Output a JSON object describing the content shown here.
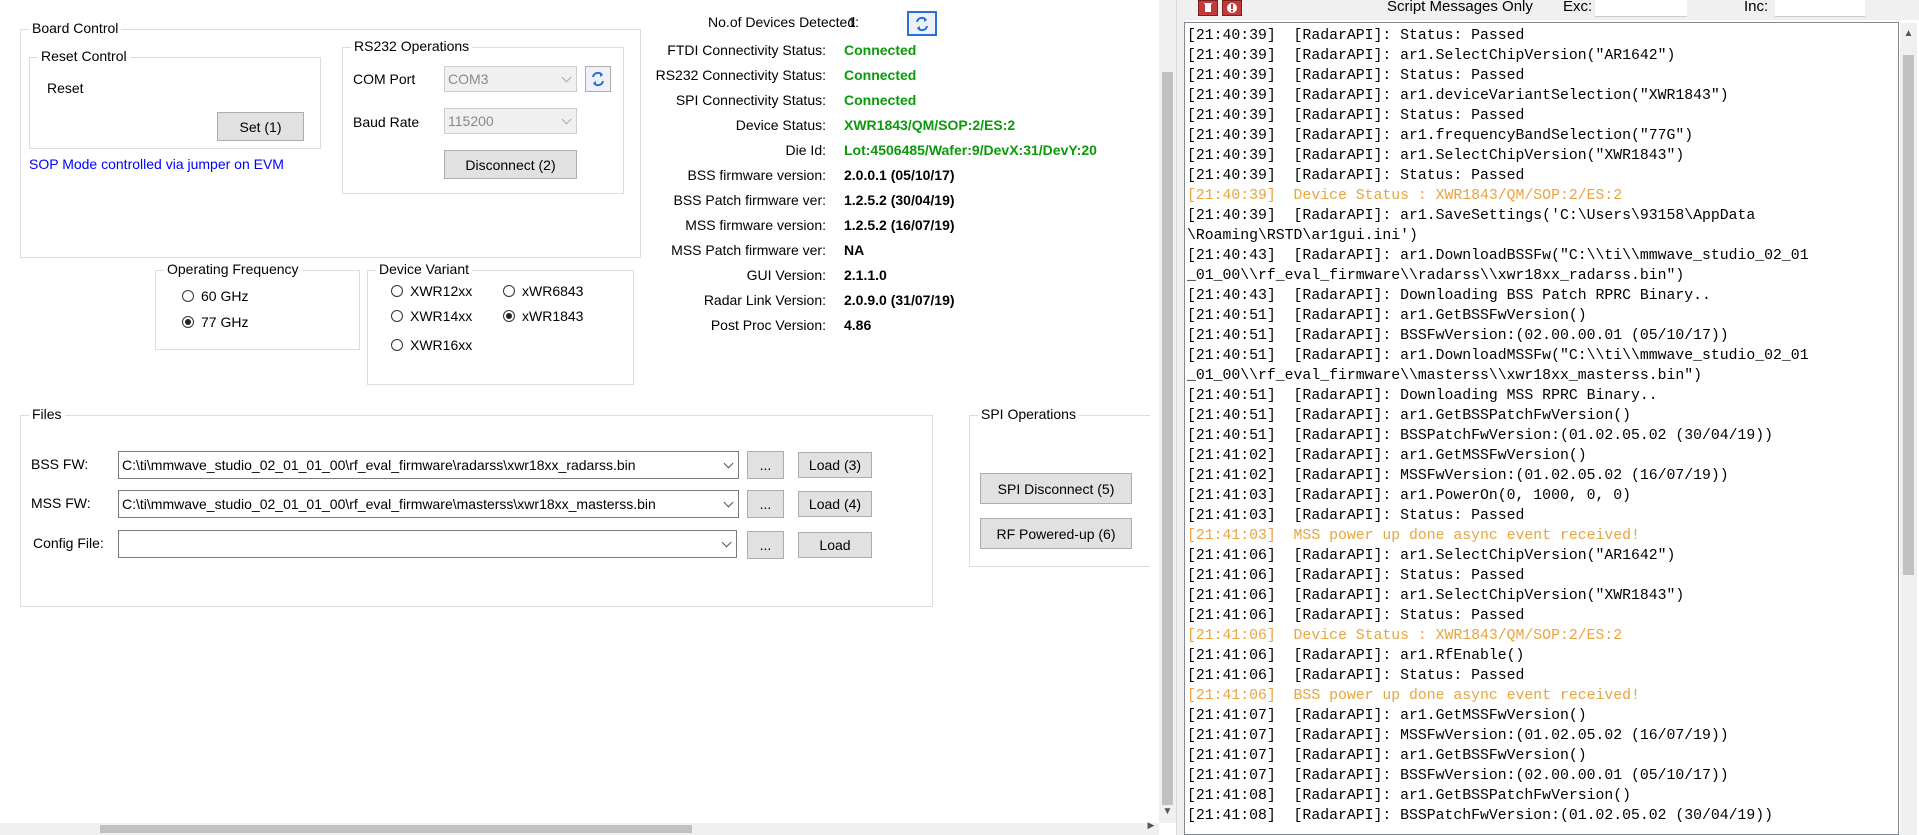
{
  "board_control": {
    "title": "Board Control",
    "reset_control": {
      "title": "Reset Control",
      "reset_label": "Reset",
      "set_button": "Set (1)"
    },
    "rs232": {
      "title": "RS232 Operations",
      "com_port_label": "COM Port",
      "com_port_value": "COM3",
      "baud_rate_label": "Baud Rate",
      "baud_rate_value": "115200",
      "disconnect_button": "Disconnect (2)"
    },
    "sop_note": "SOP Mode controlled via jumper on EVM"
  },
  "operating_frequency": {
    "title": "Operating Frequency",
    "options": [
      {
        "label": "60 GHz",
        "selected": false
      },
      {
        "label": "77 GHz",
        "selected": true
      }
    ]
  },
  "device_variant": {
    "title": "Device Variant",
    "options": [
      {
        "label": "XWR12xx",
        "selected": false
      },
      {
        "label": "xWR6843",
        "selected": false
      },
      {
        "label": "XWR14xx",
        "selected": false
      },
      {
        "label": "xWR1843",
        "selected": true
      },
      {
        "label": "XWR16xx",
        "selected": false
      }
    ]
  },
  "status": {
    "devices_label": "No.of Devices Detected:",
    "devices_value": "1",
    "rows": [
      {
        "label": "FTDI Connectivity Status:",
        "value": "Connected",
        "color": "#0a9a0a"
      },
      {
        "label": "RS232 Connectivity Status:",
        "value": "Connected",
        "color": "#0a9a0a"
      },
      {
        "label": "SPI Connectivity Status:",
        "value": "Connected",
        "color": "#0a9a0a"
      },
      {
        "label": "Device Status:",
        "value": "XWR1843/QM/SOP:2/ES:2",
        "color": "#0a9a0a"
      },
      {
        "label": "Die Id:",
        "value": "Lot:4506485/Wafer:9/DevX:31/DevY:20",
        "color": "#0a9a0a"
      },
      {
        "label": "BSS firmware version:",
        "value": "2.0.0.1 (05/10/17)",
        "color": "#000000"
      },
      {
        "label": "BSS Patch firmware ver:",
        "value": "1.2.5.2 (30/04/19)",
        "color": "#000000"
      },
      {
        "label": "MSS firmware version:",
        "value": "1.2.5.2 (16/07/19)",
        "color": "#000000"
      },
      {
        "label": "MSS Patch firmware ver:",
        "value": "NA",
        "color": "#000000"
      },
      {
        "label": "GUI Version:",
        "value": "2.1.1.0",
        "color": "#000000"
      },
      {
        "label": "Radar Link Version:",
        "value": "2.0.9.0 (31/07/19)",
        "color": "#000000"
      },
      {
        "label": "Post Proc Version:",
        "value": "4.86",
        "color": "#000000"
      }
    ]
  },
  "files": {
    "title": "Files",
    "bss_label": "BSS FW:",
    "bss_path": "C:\\ti\\mmwave_studio_02_01_01_00\\rf_eval_firmware\\radarss\\xwr18xx_radarss.bin",
    "bss_load": "Load (3)",
    "mss_label": "MSS FW:",
    "mss_path": "C:\\ti\\mmwave_studio_02_01_01_00\\rf_eval_firmware\\masterss\\xwr18xx_masterss.bin",
    "mss_load": "Load (4)",
    "config_label": "Config File:",
    "config_path": "",
    "config_load": "Load",
    "browse": "..."
  },
  "spi": {
    "title": "SPI Operations",
    "disconnect": "SPI Disconnect (5)",
    "rf_powered": "RF Powered-up (6)"
  },
  "script_toolbar": {
    "script_messages_only": "Script Messages Only",
    "exc_label": "Exc:",
    "inc_label": "Inc:"
  },
  "log": [
    {
      "text": "[21:40:39]  [RadarAPI]: Status: Passed",
      "hl": false
    },
    {
      "text": "[21:40:39]  [RadarAPI]: ar1.SelectChipVersion(\"AR1642\")",
      "hl": false
    },
    {
      "text": "[21:40:39]  [RadarAPI]: Status: Passed",
      "hl": false
    },
    {
      "text": "[21:40:39]  [RadarAPI]: ar1.deviceVariantSelection(\"XWR1843\")",
      "hl": false
    },
    {
      "text": "[21:40:39]  [RadarAPI]: Status: Passed",
      "hl": false
    },
    {
      "text": "[21:40:39]  [RadarAPI]: ar1.frequencyBandSelection(\"77G\")",
      "hl": false
    },
    {
      "text": "[21:40:39]  [RadarAPI]: ar1.SelectChipVersion(\"XWR1843\")",
      "hl": false
    },
    {
      "text": "[21:40:39]  [RadarAPI]: Status: Passed",
      "hl": false
    },
    {
      "text": "[21:40:39]  Device Status : XWR1843/QM/SOP:2/ES:2",
      "hl": true
    },
    {
      "text": "[21:40:39]  [RadarAPI]: ar1.SaveSettings('C:\\Users\\93158\\AppData",
      "hl": false
    },
    {
      "text": "\\Roaming\\RSTD\\ar1gui.ini')",
      "hl": false
    },
    {
      "text": "[21:40:43]  [RadarAPI]: ar1.DownloadBSSFw(\"C:\\\\ti\\\\mmwave_studio_02_01",
      "hl": false
    },
    {
      "text": "_01_00\\\\rf_eval_firmware\\\\radarss\\\\xwr18xx_radarss.bin\")",
      "hl": false
    },
    {
      "text": "[21:40:43]  [RadarAPI]: Downloading BSS Patch RPRC Binary..",
      "hl": false
    },
    {
      "text": "[21:40:51]  [RadarAPI]: ar1.GetBSSFwVersion()",
      "hl": false
    },
    {
      "text": "[21:40:51]  [RadarAPI]: BSSFwVersion:(02.00.00.01 (05/10/17))",
      "hl": false
    },
    {
      "text": "[21:40:51]  [RadarAPI]: ar1.DownloadMSSFw(\"C:\\\\ti\\\\mmwave_studio_02_01",
      "hl": false
    },
    {
      "text": "_01_00\\\\rf_eval_firmware\\\\masterss\\\\xwr18xx_masterss.bin\")",
      "hl": false
    },
    {
      "text": "[21:40:51]  [RadarAPI]: Downloading MSS RPRC Binary..",
      "hl": false
    },
    {
      "text": "[21:40:51]  [RadarAPI]: ar1.GetBSSPatchFwVersion()",
      "hl": false
    },
    {
      "text": "[21:40:51]  [RadarAPI]: BSSPatchFwVersion:(01.02.05.02 (30/04/19))",
      "hl": false
    },
    {
      "text": "[21:41:02]  [RadarAPI]: ar1.GetMSSFwVersion()",
      "hl": false
    },
    {
      "text": "[21:41:02]  [RadarAPI]: MSSFwVersion:(01.02.05.02 (16/07/19))",
      "hl": false
    },
    {
      "text": "[21:41:03]  [RadarAPI]: ar1.PowerOn(0, 1000, 0, 0)",
      "hl": false
    },
    {
      "text": "[21:41:03]  [RadarAPI]: Status: Passed",
      "hl": false
    },
    {
      "text": "[21:41:03]  MSS power up done async event received!",
      "hl": true
    },
    {
      "text": "[21:41:06]  [RadarAPI]: ar1.SelectChipVersion(\"AR1642\")",
      "hl": false
    },
    {
      "text": "[21:41:06]  [RadarAPI]: Status: Passed",
      "hl": false
    },
    {
      "text": "[21:41:06]  [RadarAPI]: ar1.SelectChipVersion(\"XWR1843\")",
      "hl": false
    },
    {
      "text": "[21:41:06]  [RadarAPI]: Status: Passed",
      "hl": false
    },
    {
      "text": "[21:41:06]  Device Status : XWR1843/QM/SOP:2/ES:2",
      "hl": true
    },
    {
      "text": "[21:41:06]  [RadarAPI]: ar1.RfEnable()",
      "hl": false
    },
    {
      "text": "[21:41:06]  [RadarAPI]: Status: Passed",
      "hl": false
    },
    {
      "text": "[21:41:06]  BSS power up done async event received!",
      "hl": true
    },
    {
      "text": "[21:41:07]  [RadarAPI]: ar1.GetMSSFwVersion()",
      "hl": false
    },
    {
      "text": "[21:41:07]  [RadarAPI]: MSSFwVersion:(01.02.05.02 (16/07/19))",
      "hl": false
    },
    {
      "text": "[21:41:07]  [RadarAPI]: ar1.GetBSSFwVersion()",
      "hl": false
    },
    {
      "text": "[21:41:07]  [RadarAPI]: BSSFwVersion:(02.00.00.01 (05/10/17))",
      "hl": false
    },
    {
      "text": "[21:41:08]  [RadarAPI]: ar1.GetBSSPatchFwVersion()",
      "hl": false
    },
    {
      "text": "[21:41:08]  [RadarAPI]: BSSPatchFwVersion:(01.02.05.02 (30/04/19))",
      "hl": false
    }
  ],
  "colors": {
    "highlight": "#e8a33d",
    "link_blue": "#0000ff",
    "status_green": "#0a9a0a"
  }
}
